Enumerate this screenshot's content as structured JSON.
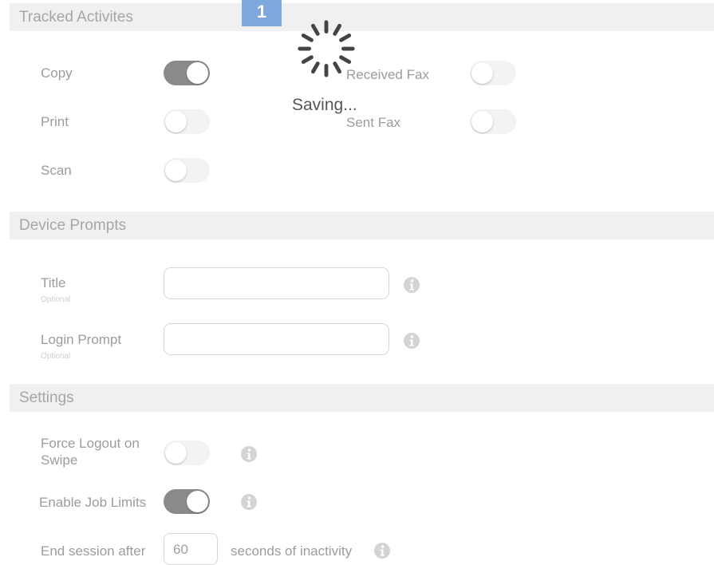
{
  "sections": {
    "tracked": "Tracked Activites",
    "prompts": "Device Prompts",
    "settings": "Settings"
  },
  "badge": "1",
  "saving": "Saving...",
  "activities": {
    "copy": {
      "label": "Copy",
      "on": true
    },
    "print": {
      "label": "Print",
      "on": false
    },
    "scan": {
      "label": "Scan",
      "on": false
    },
    "received_fax": {
      "label": "Received Fax",
      "on": false
    },
    "sent_fax": {
      "label": "Sent Fax",
      "on": false
    }
  },
  "prompts": {
    "title": {
      "label": "Title",
      "hint": "Optional",
      "value": ""
    },
    "login": {
      "label": "Login Prompt",
      "hint": "Optional",
      "value": ""
    }
  },
  "settings": {
    "force_logout": {
      "label_line1": "Force Logout on",
      "label_line2": "Swipe",
      "on": false
    },
    "job_limits": {
      "label": "Enable Job Limits",
      "on": true
    },
    "end_session": {
      "prefix": "End session after",
      "value": "60",
      "suffix": "seconds of inactivity"
    }
  },
  "colors": {
    "badge": "#7ea7dc",
    "toggle_on": "#8a8a8a",
    "toggle_off": "#f3f3f3",
    "header_bg": "#f0f0f0"
  },
  "icons": {
    "info": "info-circle-icon",
    "spinner": "spinner-icon"
  }
}
